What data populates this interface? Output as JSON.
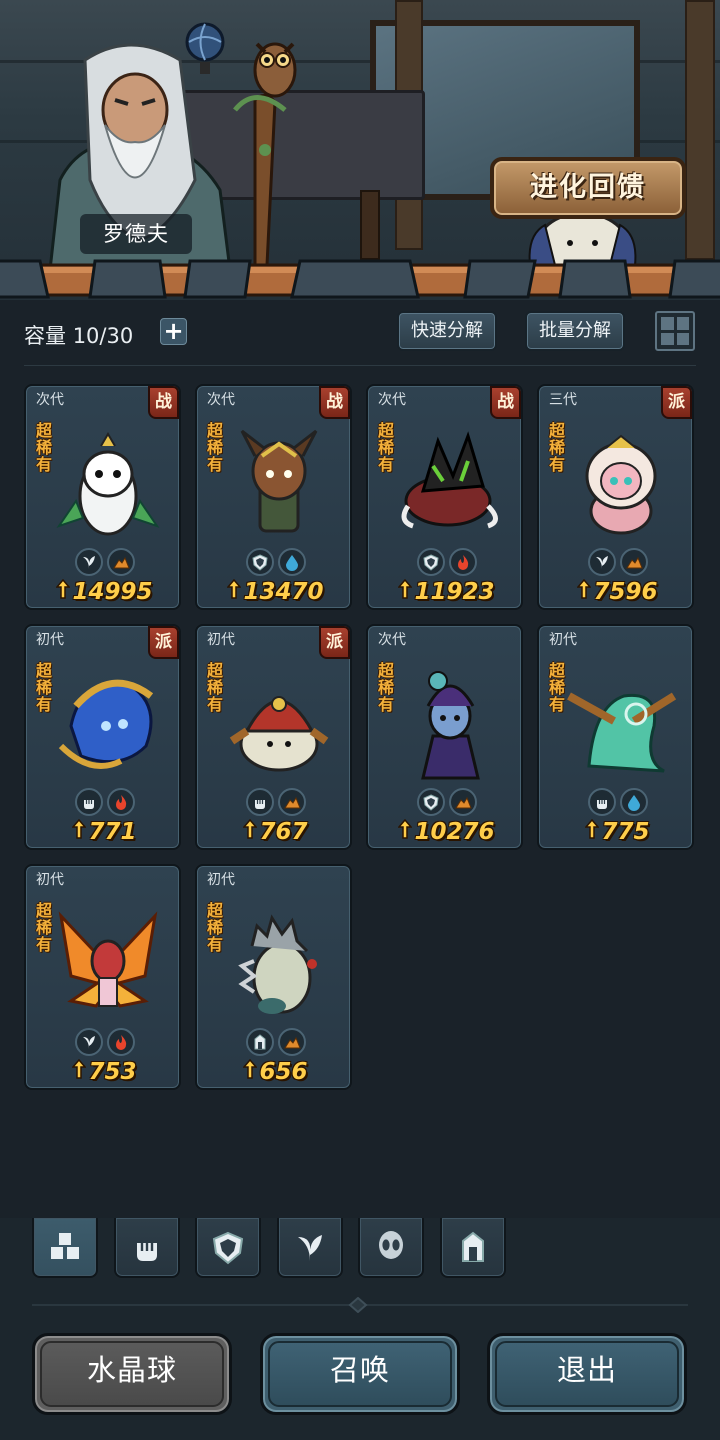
{
  "header": {
    "npc_name": "罗德夫",
    "evolution_button": "进化回馈"
  },
  "toolbar": {
    "capacity_label": "容量",
    "capacity_value": "10/30",
    "add_capacity_glyph": "+",
    "quick_decompose": "快速分解",
    "batch_decompose": "批量分解",
    "view_toggle_icon": "grid-view-icon"
  },
  "cards": [
    {
      "generation": "次代",
      "badge": "战",
      "rarity": "超稀有",
      "power": "14995",
      "type_icons": [
        "leaf-icon",
        "earth-icon"
      ]
    },
    {
      "generation": "次代",
      "badge": "战",
      "rarity": "超稀有",
      "power": "13470",
      "type_icons": [
        "shield-icon",
        "water-icon"
      ]
    },
    {
      "generation": "次代",
      "badge": "战",
      "rarity": "超稀有",
      "power": "11923",
      "type_icons": [
        "shield-icon",
        "fire-icon"
      ]
    },
    {
      "generation": "三代",
      "badge": "派",
      "rarity": "超稀有",
      "power": "7596",
      "type_icons": [
        "leaf-icon",
        "earth-icon"
      ]
    },
    {
      "generation": "初代",
      "badge": "派",
      "rarity": "超稀有",
      "power": "771",
      "type_icons": [
        "fist-icon",
        "fire-icon"
      ]
    },
    {
      "generation": "初代",
      "badge": "派",
      "rarity": "超稀有",
      "power": "767",
      "type_icons": [
        "fist-icon",
        "earth-icon"
      ]
    },
    {
      "generation": "次代",
      "badge": "",
      "rarity": "超稀有",
      "power": "10276",
      "type_icons": [
        "shield-icon",
        "earth-icon"
      ]
    },
    {
      "generation": "初代",
      "badge": "",
      "rarity": "超稀有",
      "power": "775",
      "type_icons": [
        "fist-icon",
        "water-icon"
      ]
    },
    {
      "generation": "初代",
      "badge": "",
      "rarity": "超稀有",
      "power": "753",
      "type_icons": [
        "leaf-icon",
        "fire-icon"
      ]
    },
    {
      "generation": "初代",
      "badge": "",
      "rarity": "超稀有",
      "power": "656",
      "type_icons": [
        "tower-icon",
        "earth-icon"
      ]
    }
  ],
  "filter_tabs": [
    {
      "icon": "all-blocks-icon",
      "active": true
    },
    {
      "icon": "fist-icon",
      "active": false
    },
    {
      "icon": "shield-icon",
      "active": false
    },
    {
      "icon": "leaf-icon",
      "active": false
    },
    {
      "icon": "alien-head-icon",
      "active": false
    },
    {
      "icon": "tower-icon",
      "active": false
    }
  ],
  "buttons": {
    "crystal_ball": "水晶球",
    "summon": "召唤",
    "exit": "退出"
  },
  "colors": {
    "background": "#1a2229",
    "card": "#2f4250",
    "power_text": "#ffce4a",
    "rarity_text": "#f3b13b",
    "badge": "#a8402e"
  }
}
